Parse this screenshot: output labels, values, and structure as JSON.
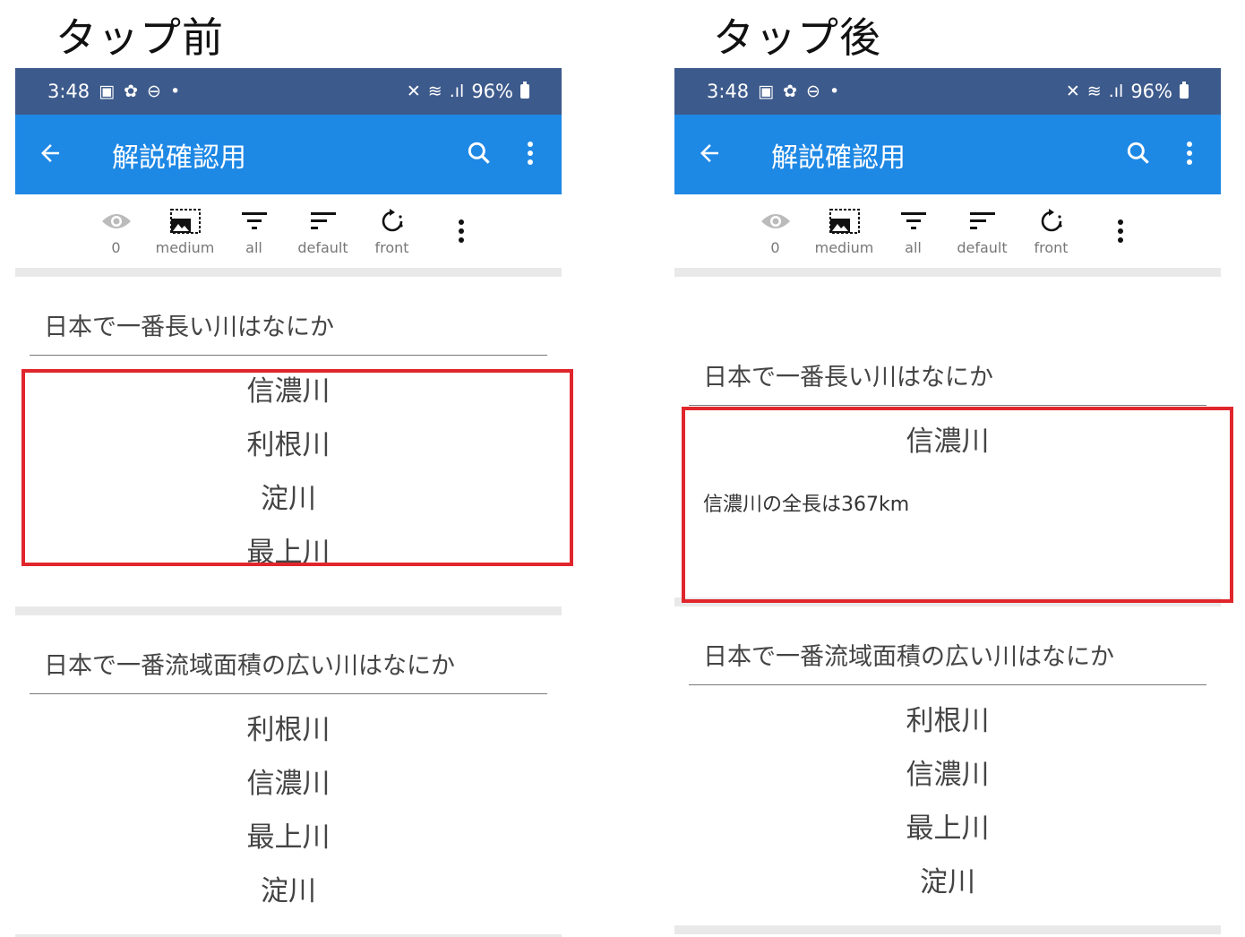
{
  "panels": [
    {
      "heading": "タップ前",
      "status": {
        "time": "3:48",
        "battery": "96%"
      },
      "appbar": {
        "title": "解説確認用"
      },
      "toolbar": {
        "items": [
          {
            "icon": "eye-icon",
            "label": "0"
          },
          {
            "icon": "image-size-icon",
            "label": "medium"
          },
          {
            "icon": "filter-icon",
            "label": "all"
          },
          {
            "icon": "sort-icon",
            "label": "default"
          },
          {
            "icon": "rotate-icon",
            "label": "front"
          }
        ]
      },
      "cards": [
        {
          "question": "日本で一番長い川はなにか",
          "options": [
            "信濃川",
            "利根川",
            "淀川",
            "最上川"
          ]
        },
        {
          "question": "日本で一番流域面積の広い川はなにか",
          "options": [
            "利根川",
            "信濃川",
            "最上川",
            "淀川"
          ]
        }
      ]
    },
    {
      "heading": "タップ後",
      "status": {
        "time": "3:48",
        "battery": "96%"
      },
      "appbar": {
        "title": "解説確認用"
      },
      "toolbar": {
        "items": [
          {
            "icon": "eye-icon",
            "label": "0"
          },
          {
            "icon": "image-size-icon",
            "label": "medium"
          },
          {
            "icon": "filter-icon",
            "label": "all"
          },
          {
            "icon": "sort-icon",
            "label": "default"
          },
          {
            "icon": "rotate-icon",
            "label": "front"
          }
        ]
      },
      "cards": [
        {
          "question": "日本で一番長い川はなにか",
          "answer": "信濃川",
          "explanation": "信濃川の全長は367km"
        },
        {
          "question": "日本で一番流域面積の広い川はなにか",
          "options": [
            "利根川",
            "信濃川",
            "最上川",
            "淀川"
          ]
        }
      ]
    }
  ],
  "colors": {
    "status_bar": "#3d5a8c",
    "app_bar": "#1e88e5",
    "highlight": "#e0262c"
  }
}
